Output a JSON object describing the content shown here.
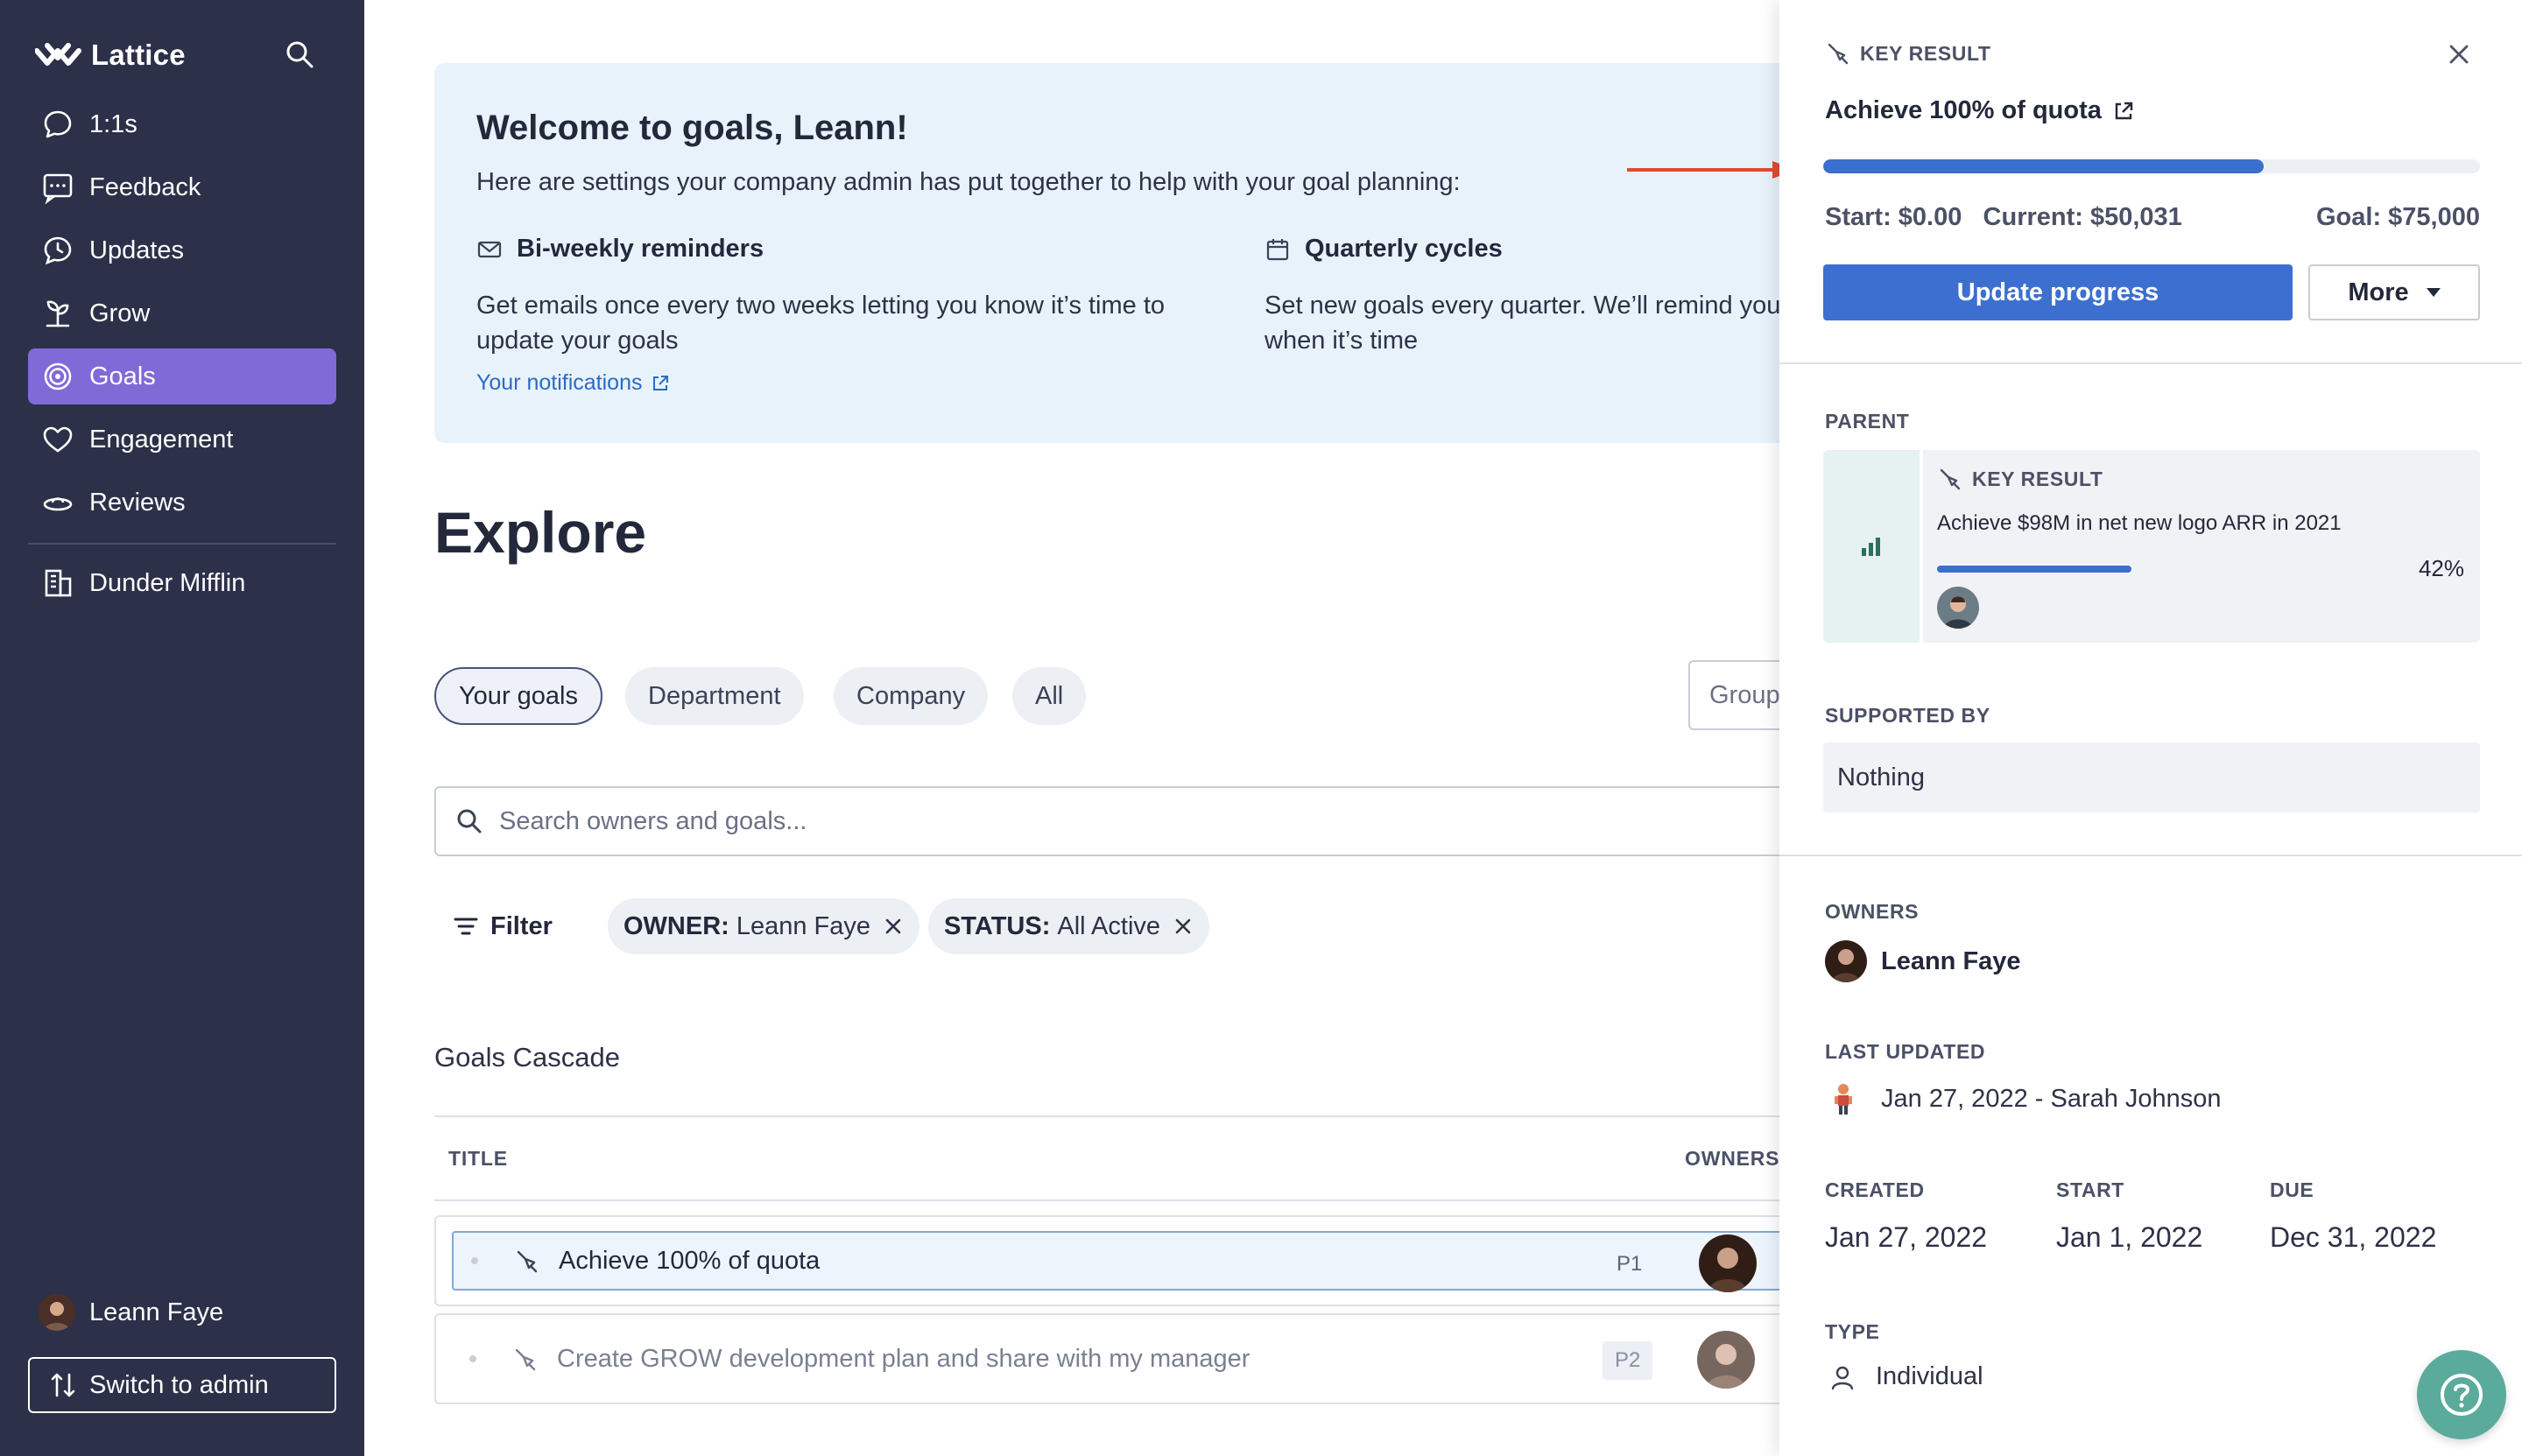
{
  "sidebar": {
    "brand": "Lattice",
    "items": [
      {
        "label": "1:1s",
        "icon": "chat-bubble-icon"
      },
      {
        "label": "Feedback",
        "icon": "feedback-icon"
      },
      {
        "label": "Updates",
        "icon": "updates-icon"
      },
      {
        "label": "Grow",
        "icon": "grow-icon"
      },
      {
        "label": "Goals",
        "icon": "target-icon",
        "active": true
      },
      {
        "label": "Engagement",
        "icon": "heart-icon"
      },
      {
        "label": "Reviews",
        "icon": "reviews-icon"
      }
    ],
    "company": "Dunder Mifflin",
    "user_name": "Leann Faye",
    "switch_label": "Switch to admin"
  },
  "welcome": {
    "title": "Welcome to goals, Leann!",
    "subtitle": "Here are settings your company admin has put together to help with your goal planning:",
    "feature1_title": "Bi-weekly reminders",
    "feature1_desc": "Get emails once every two weeks letting you know it’s time to update your goals",
    "feature1_link": "Your notifications",
    "feature2_title": "Quarterly cycles",
    "feature2_desc": "Set new goals every quarter. We’ll remind you when it’s time"
  },
  "explore": {
    "heading": "Explore",
    "tabs": [
      "Your goals",
      "Department",
      "Company",
      "All"
    ],
    "group_label": "Group",
    "search_placeholder": "Search owners and goals...",
    "filter_label": "Filter",
    "filter_owner_key": "OWNER:",
    "filter_owner_value": "Leann Faye",
    "filter_status_key": "STATUS:",
    "filter_status_value": "All Active"
  },
  "cascade": {
    "title": "Goals Cascade",
    "col_title": "TITLE",
    "col_owners": "OWNERS",
    "rows": [
      {
        "title": "Achieve 100% of quota",
        "priority": "P1"
      },
      {
        "title": "Create GROW development plan and share with my manager",
        "priority": "P2"
      }
    ]
  },
  "panel": {
    "eyebrow": "KEY RESULT",
    "title": "Achieve 100% of quota",
    "progress": 0.67,
    "start_label": "Start: $0.00",
    "current_label": "Current: $50,031",
    "goal_label": "Goal: $75,000",
    "update_button": "Update progress",
    "more_button": "More",
    "parent_label": "PARENT",
    "parent_eyebrow": "KEY RESULT",
    "parent_title": "Achieve $98M in net new logo ARR in 2021",
    "parent_percent": "42%",
    "parent_progress": 0.42,
    "supported_label": "SUPPORTED BY",
    "supported_value": "Nothing",
    "owners_label": "OWNERS",
    "owner_name": "Leann Faye",
    "last_updated_label": "LAST UPDATED",
    "last_updated_value": "Jan 27, 2022 - Sarah Johnson",
    "created_label": "CREATED",
    "created_value": "Jan 27, 2022",
    "start_date_label": "START",
    "start_date_value": "Jan 1, 2022",
    "due_label": "DUE",
    "due_value": "Dec 31, 2022",
    "type_label": "TYPE",
    "type_value": "Individual"
  },
  "colors": {
    "sidebar_bg": "#2c3048",
    "nav_active": "#7f6ad8",
    "primary": "#3c6fcf",
    "help_fab": "#5bab9c",
    "annotation_arrow": "#e24a2e"
  }
}
